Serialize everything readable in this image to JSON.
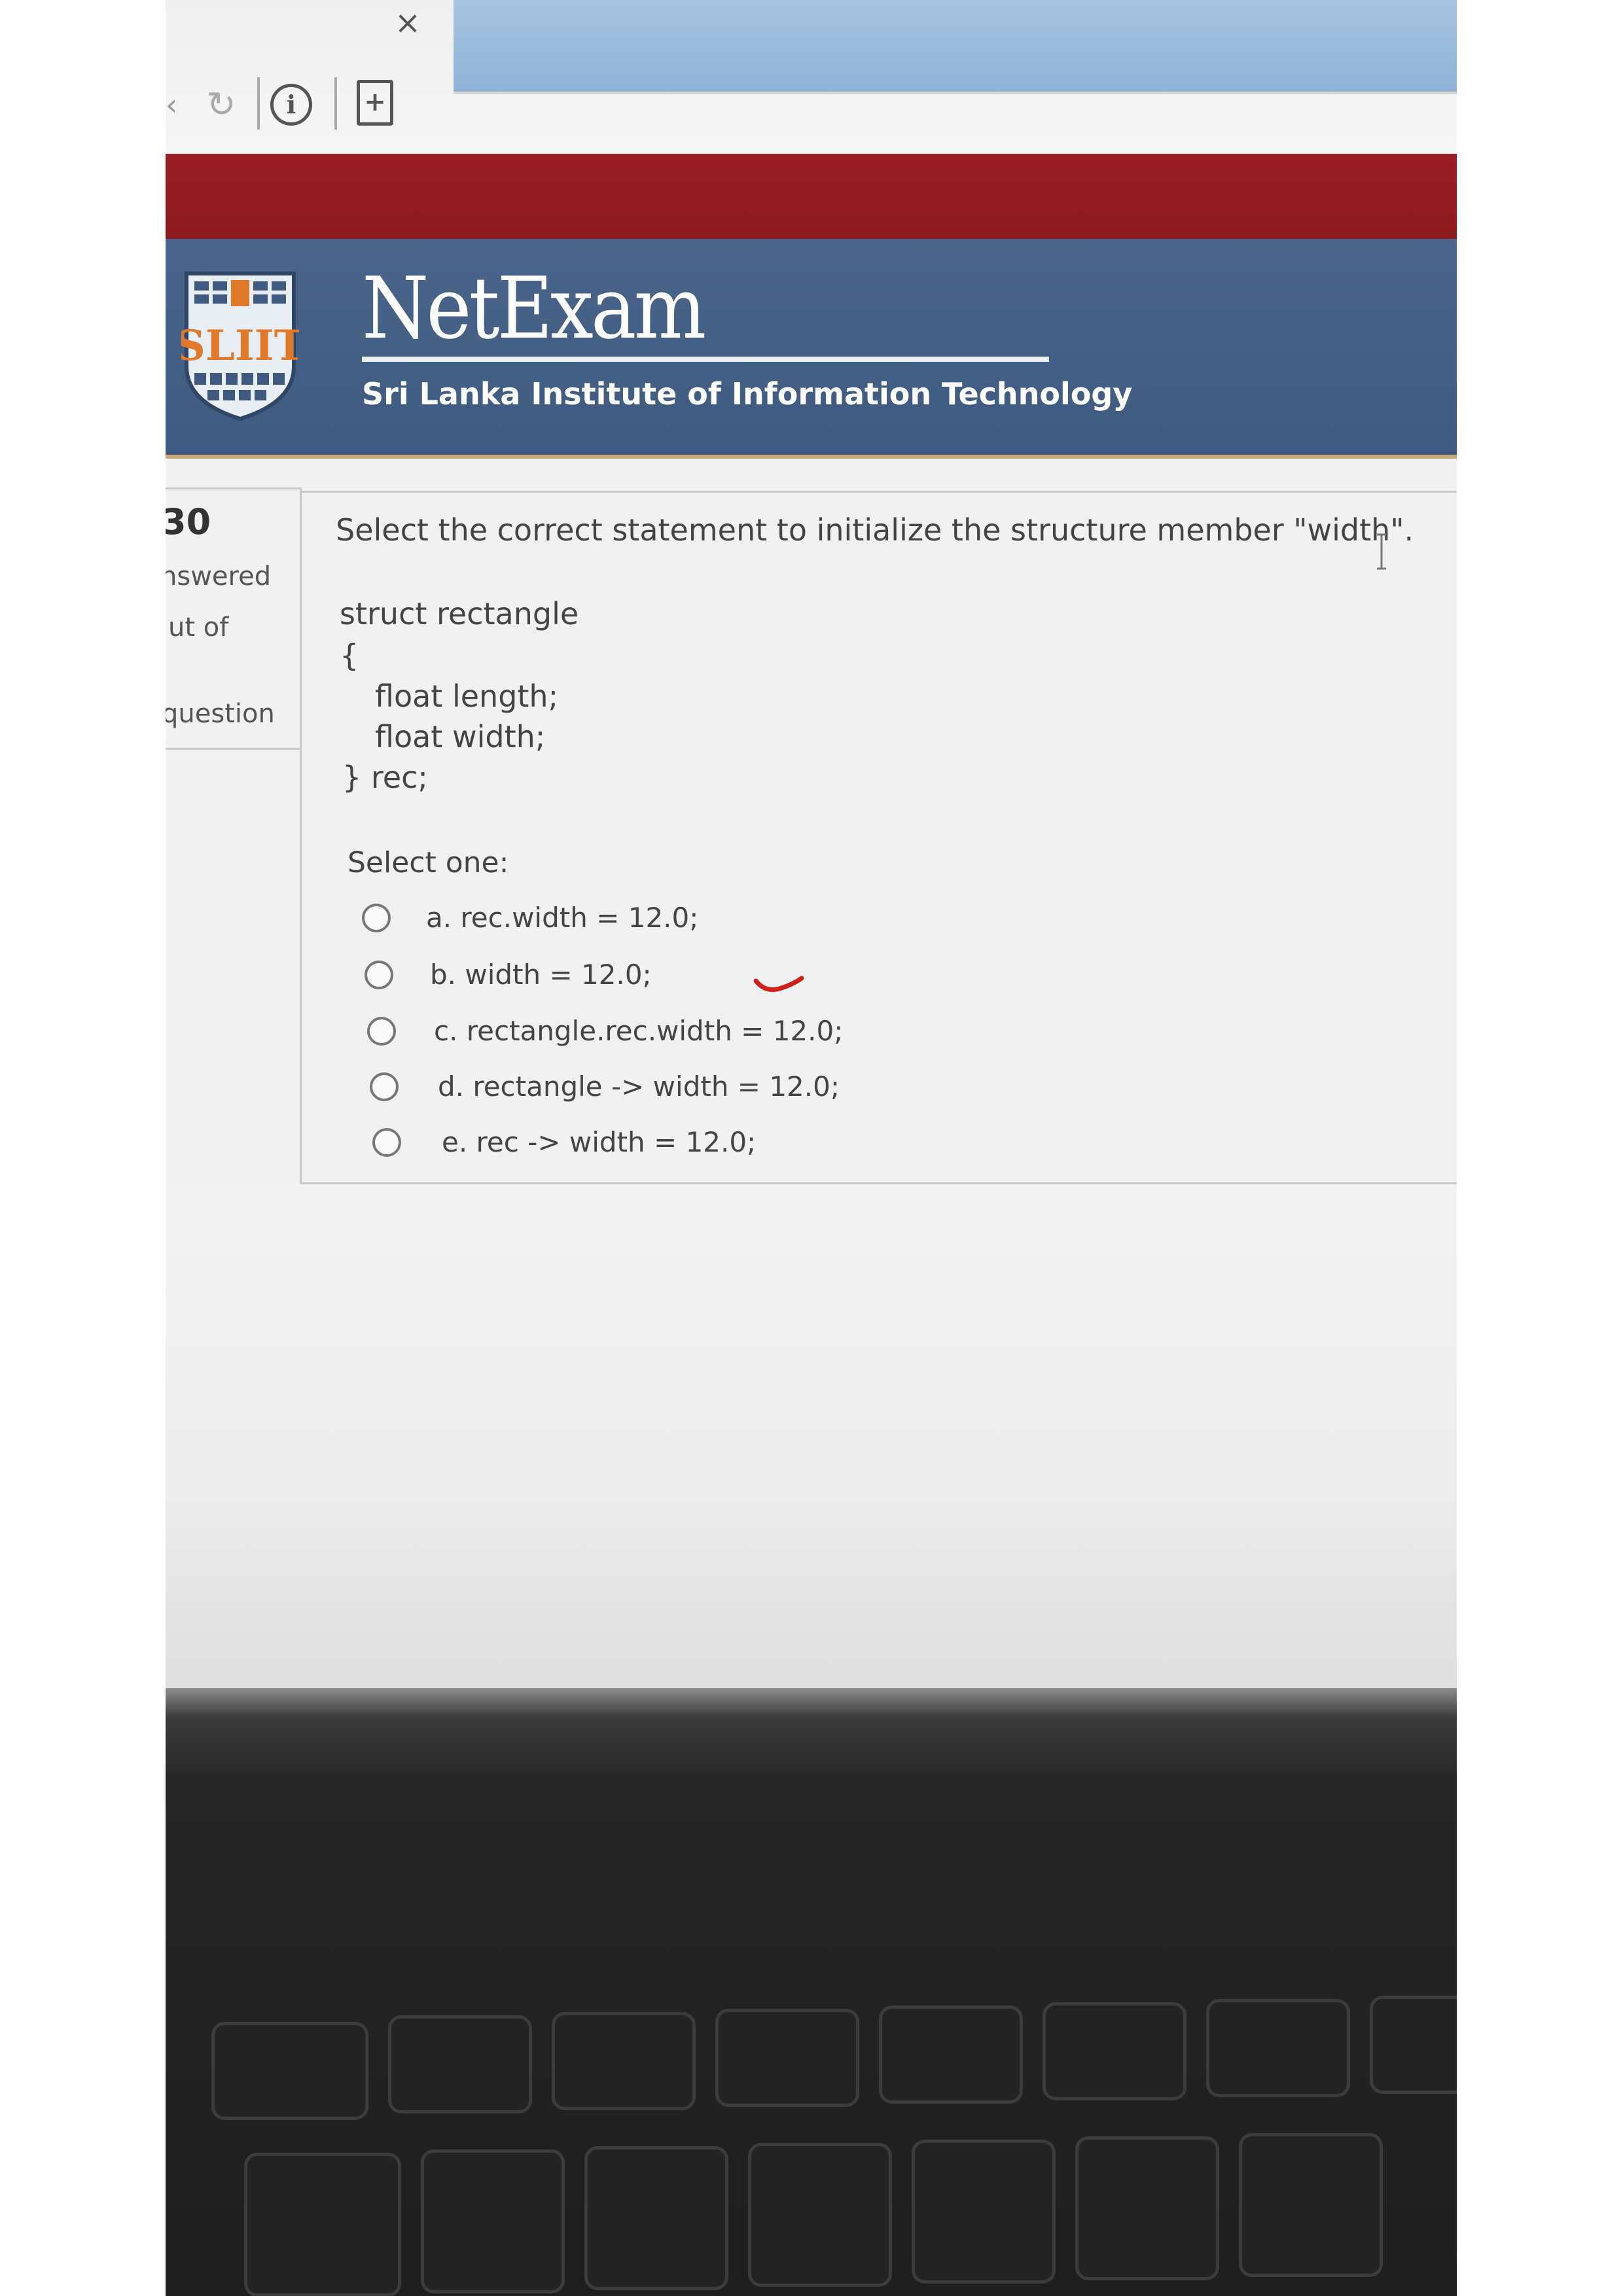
{
  "browser": {
    "tab_close_glyph": "×",
    "info_glyph": "i",
    "page_glyph": "+"
  },
  "header": {
    "logo_text": "SLIIT",
    "site_title": "NetExam",
    "site_subtitle": "Sri Lanka Institute of Information Technology",
    "colors": {
      "red_band": "#8d1a1f",
      "banner_blue": "#3e5a80",
      "logo_orange": "#e07a2a"
    }
  },
  "nav_block": {
    "number": "30",
    "answered": "nswered",
    "out_of": "ut of",
    "question": "question"
  },
  "question": {
    "prompt": "Select the correct statement to initialize the structure member \"width\".",
    "code": [
      "struct rectangle",
      "{",
      "float length;",
      "float width;",
      "} rec;"
    ],
    "select_label": "Select one:",
    "options": [
      {
        "label": "a. rec.width = 12.0;"
      },
      {
        "label": "b. width = 12.0;"
      },
      {
        "label": "c. rectangle.rec.width = 12.0;"
      },
      {
        "label": "d. rectangle -> width = 12.0;"
      },
      {
        "label": "e. rec -> width = 12.0;"
      }
    ]
  }
}
